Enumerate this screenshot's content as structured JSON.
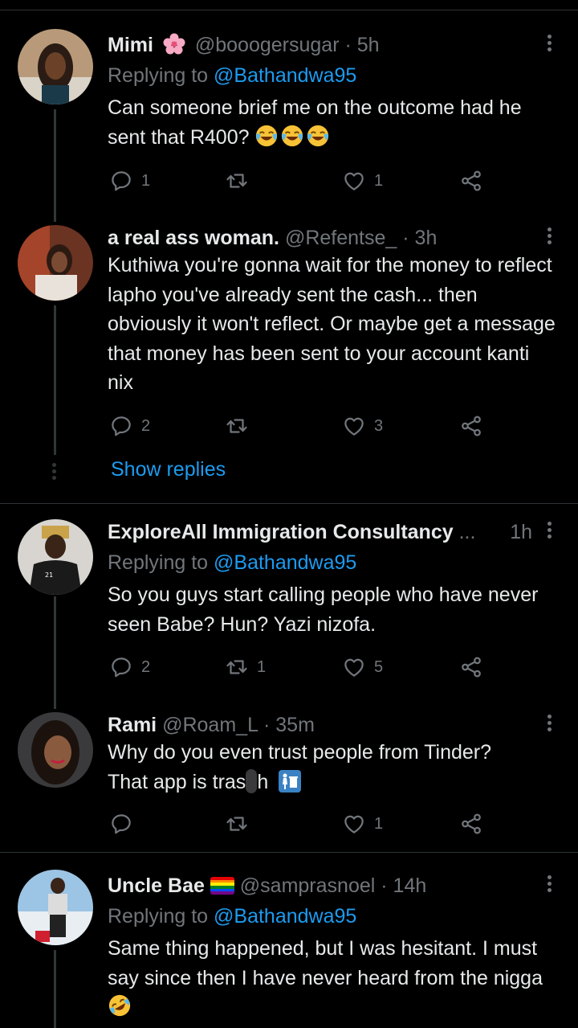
{
  "tweets": [
    {
      "name": "Mimi",
      "handle": "@booogersugar",
      "dot": "·",
      "time": "5h",
      "replying_prefix": "Replying to",
      "replying_to": "@Bathandwa95",
      "text": "Can someone brief me on the outcome had he sent that R400?",
      "emoji_after": "face-with-tears-of-joy x3",
      "counts": {
        "reply": "1",
        "retweet": "",
        "like": "1"
      }
    },
    {
      "name": "a real ass woman.",
      "handle": "@Refentse_",
      "dot": "·",
      "time": "3h",
      "text": "Kuthiwa you're gonna wait for the money to reflect lapho you've already sent the cash... then obviously it won't reflect. Or maybe get a message that money has been sent to your account kanti nix",
      "counts": {
        "reply": "2",
        "retweet": "",
        "like": "3"
      },
      "show_replies": "Show replies"
    },
    {
      "name": "ExploreAll Immigration Consultancy",
      "handle": "..",
      "dot": ".",
      "time": "1h",
      "replying_prefix": "Replying to",
      "replying_to": "@Bathandwa95",
      "text": "So you guys start calling people who have never seen Babe? Hun? Yazi nizofa.",
      "counts": {
        "reply": "2",
        "retweet": "1",
        "like": "5"
      }
    },
    {
      "name": "Rami",
      "handle": "@Roam_L",
      "dot": "·",
      "time": "35m",
      "text_line1": "Why do you even trust people from Tinder?",
      "text_line2": "That app is tras",
      "text_line2_end": "h",
      "counts": {
        "reply": "",
        "retweet": "",
        "like": "1"
      }
    },
    {
      "name": "Uncle Bae",
      "handle": "@samprasnoel",
      "dot": "·",
      "time": "14h",
      "replying_prefix": "Replying to",
      "replying_to": "@Bathandwa95",
      "text": "Same thing happened, but I was hesitant. I must say since then I have never heard from the nigga",
      "counts": {}
    }
  ],
  "colors": {
    "background": "#000000",
    "text": "#e7e9ea",
    "secondary": "#71767b",
    "link": "#1d9bf0",
    "divider": "#2f3336"
  }
}
